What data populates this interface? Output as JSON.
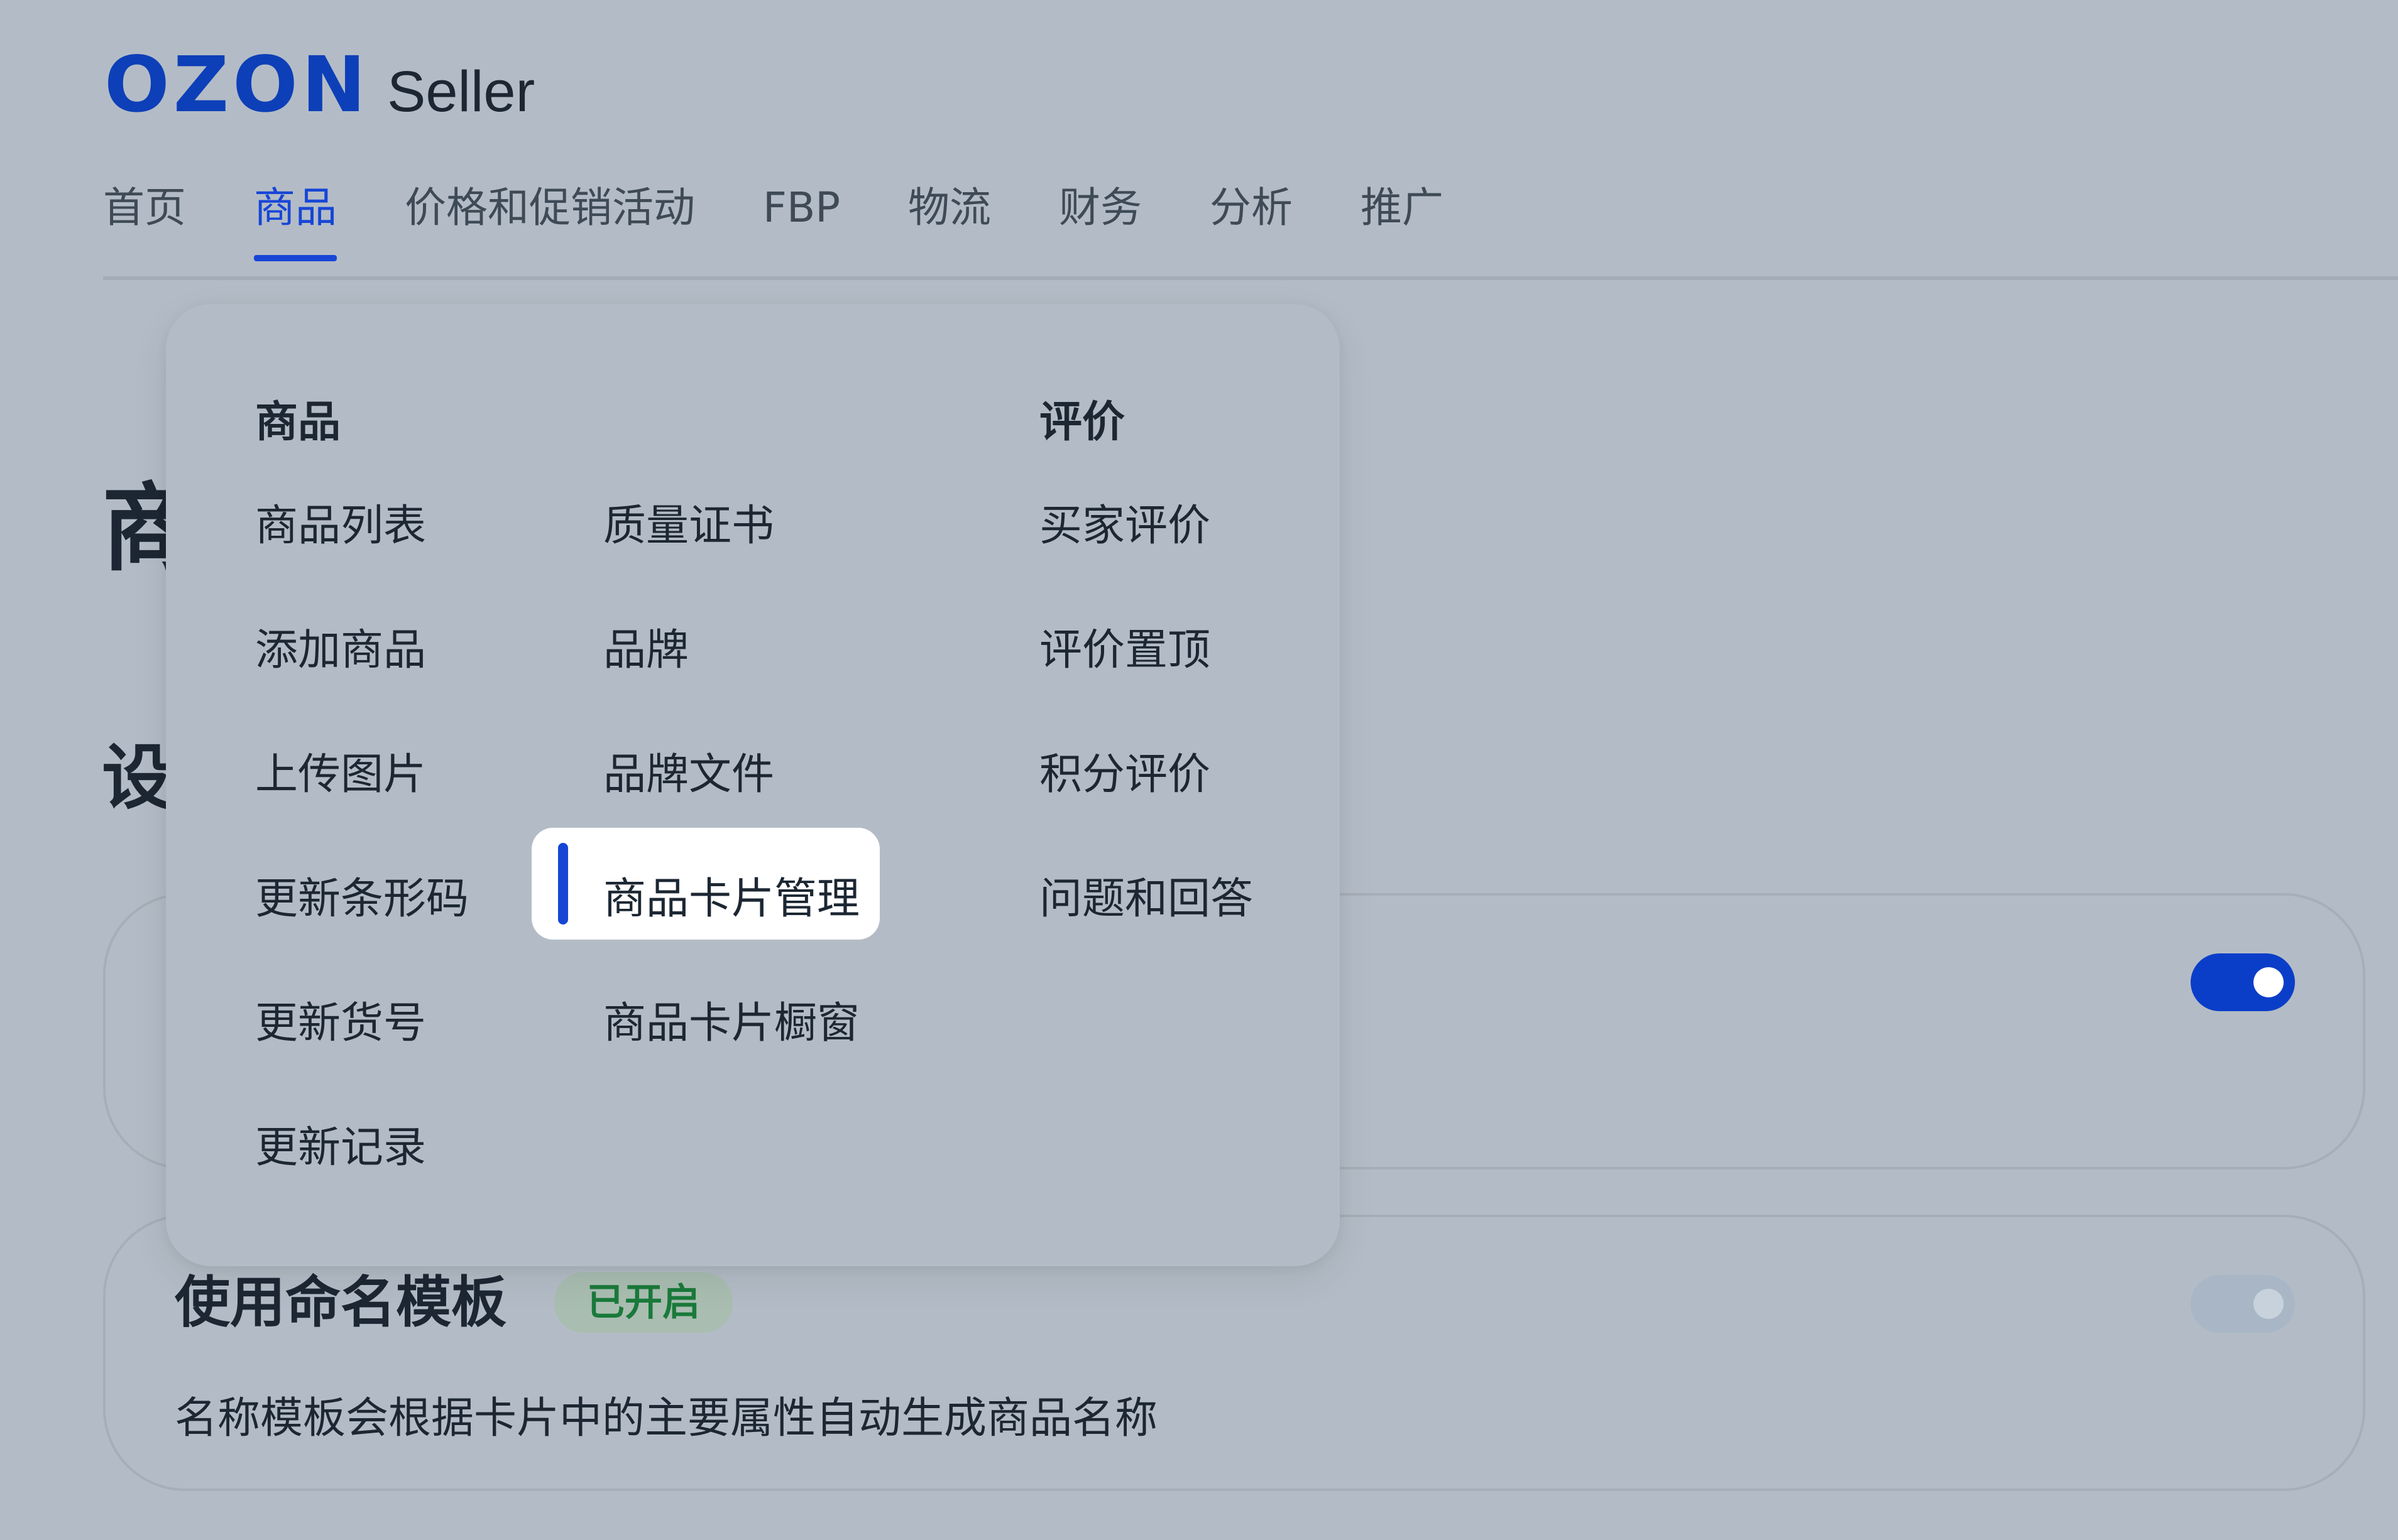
{
  "brand": {
    "logo_text": "OZON",
    "suffix": "Seller",
    "color": "#0d3fb8"
  },
  "nav": {
    "tabs": [
      {
        "label": "首页",
        "active": false
      },
      {
        "label": "商品",
        "active": true
      },
      {
        "label": "价格和促销活动",
        "active": false
      },
      {
        "label": "FBP",
        "active": false
      },
      {
        "label": "物流",
        "active": false
      },
      {
        "label": "财务",
        "active": false
      },
      {
        "label": "分析",
        "active": false
      },
      {
        "label": "推广",
        "active": false
      }
    ]
  },
  "background": {
    "page_title_partial": "商",
    "section_title_partial": "设"
  },
  "menu": {
    "goods_heading": "商品",
    "reviews_heading": "评价",
    "col1": [
      "商品列表",
      "添加商品",
      "上传图片",
      "更新条形码",
      "更新货号",
      "更新记录"
    ],
    "col2": [
      "质量证书",
      "品牌",
      "品牌文件",
      "商品卡片管理",
      "商品卡片橱窗"
    ],
    "col3": [
      "买家评价",
      "评价置顶",
      "积分评价",
      "问题和回答"
    ],
    "highlighted_item": "商品卡片管理"
  },
  "settings": {
    "name_template": {
      "title": "使用命名模板",
      "status": "已开启",
      "description": "名称模板会根据卡片中的主要属性自动生成商品名称"
    }
  },
  "colors": {
    "accent": "#1746d6",
    "toggle_on": "#0b3ec8",
    "status_green": "#1a7a3a"
  }
}
